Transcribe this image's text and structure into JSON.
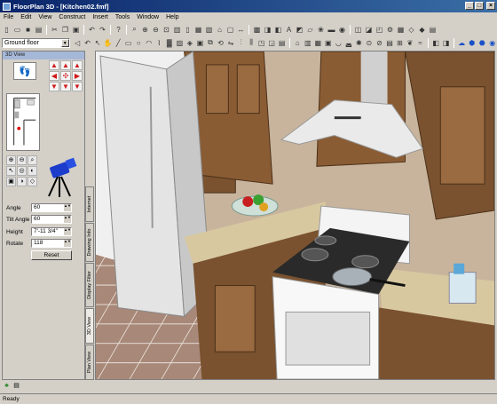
{
  "window": {
    "title": "FloorPlan 3D - [Kitchen02.fmf]"
  },
  "window_buttons": [
    "_",
    "□",
    "×"
  ],
  "menu": [
    "File",
    "Edit",
    "View",
    "Construct",
    "Insert",
    "Tools",
    "Window",
    "Help"
  ],
  "toolbar": {
    "floor_select": "Ground floor"
  },
  "left_panel": {
    "title": "3D View",
    "fields": [
      {
        "label": "Angle",
        "value": "60"
      },
      {
        "label": "Tilt Angle",
        "value": "60"
      },
      {
        "label": "Height",
        "value": "7'-11 3/4\""
      },
      {
        "label": "Rotate",
        "value": "118"
      }
    ],
    "reset_label": "Reset"
  },
  "side_tabs": [
    "Plan View",
    "3D View",
    "Display Filter",
    "Drawing Info",
    "Internet"
  ],
  "status": {
    "text": "Ready"
  },
  "colors": {
    "titlebar_start": "#0a246a",
    "titlebar_end": "#3a6ea5",
    "cabinet": "#7a5230",
    "countertop": "#d8c8a0",
    "floor_tile": "#a08070"
  }
}
